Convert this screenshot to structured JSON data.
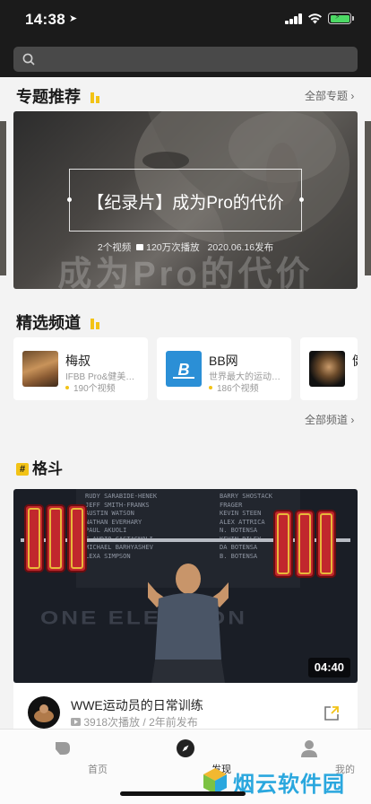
{
  "status_bar": {
    "time": "14:38",
    "location_glyph": "➤"
  },
  "search": {
    "placeholder": ""
  },
  "topics": {
    "title": "专题推荐",
    "more": "全部专题 ›",
    "banner": {
      "title": "【纪录片】成为Pro的代价",
      "videos": "2个视频",
      "plays": "120万次播放",
      "date": "2020.06.16发布",
      "overlay_text": "成为Pro的代价"
    }
  },
  "channels": {
    "title": "精选频道",
    "more": "全部频道 ›",
    "items": [
      {
        "name": "梅叔",
        "desc": "IFBB Pro&健美…",
        "count": "190个视频"
      },
      {
        "name": "BB网",
        "desc": "世界最大的运动…",
        "count": "186个视频"
      },
      {
        "name": "健",
        "desc": "",
        "count": ""
      }
    ]
  },
  "category": {
    "hash": "#",
    "title": "格斗"
  },
  "video": {
    "duration": "04:40",
    "title": "WWE运动员的日常训练",
    "plays": "3918次播放",
    "posted": "2年前发布",
    "separator": "/",
    "wall_names_left": [
      "RUDY SARABIDE-HENEK",
      "JEFF SMITH-FRANKS",
      "AUSTIN WATSON",
      "NATHAN EVERHARY",
      "PAUL AKUOLI",
      "C-AUDIO CASTAGNOLI",
      "MICHAEL BARHYASHEV",
      "LEXA SIMPSON"
    ],
    "wall_names_right": [
      "BARRY SHOSTACK",
      "FRAGER",
      "KEVIN STEEN",
      "ALEX ATTRICA",
      "N. BOTENSA",
      "KEVIN RILEY",
      "DA BOTENSA",
      "B. BOTENSA"
    ],
    "floor_text": "ONE ELECTION"
  },
  "tabbar": {
    "home": "首页",
    "discover": "发现",
    "profile": "我的"
  },
  "watermark": {
    "text": "烟云软件园"
  },
  "colors": {
    "accent": "#f2c316",
    "top_bg": "#1b1b1b",
    "page_bg": "#f3f3f3",
    "battery": "#4cd964",
    "watermark": "#2aa7de",
    "plate_red": "#c1272d"
  }
}
